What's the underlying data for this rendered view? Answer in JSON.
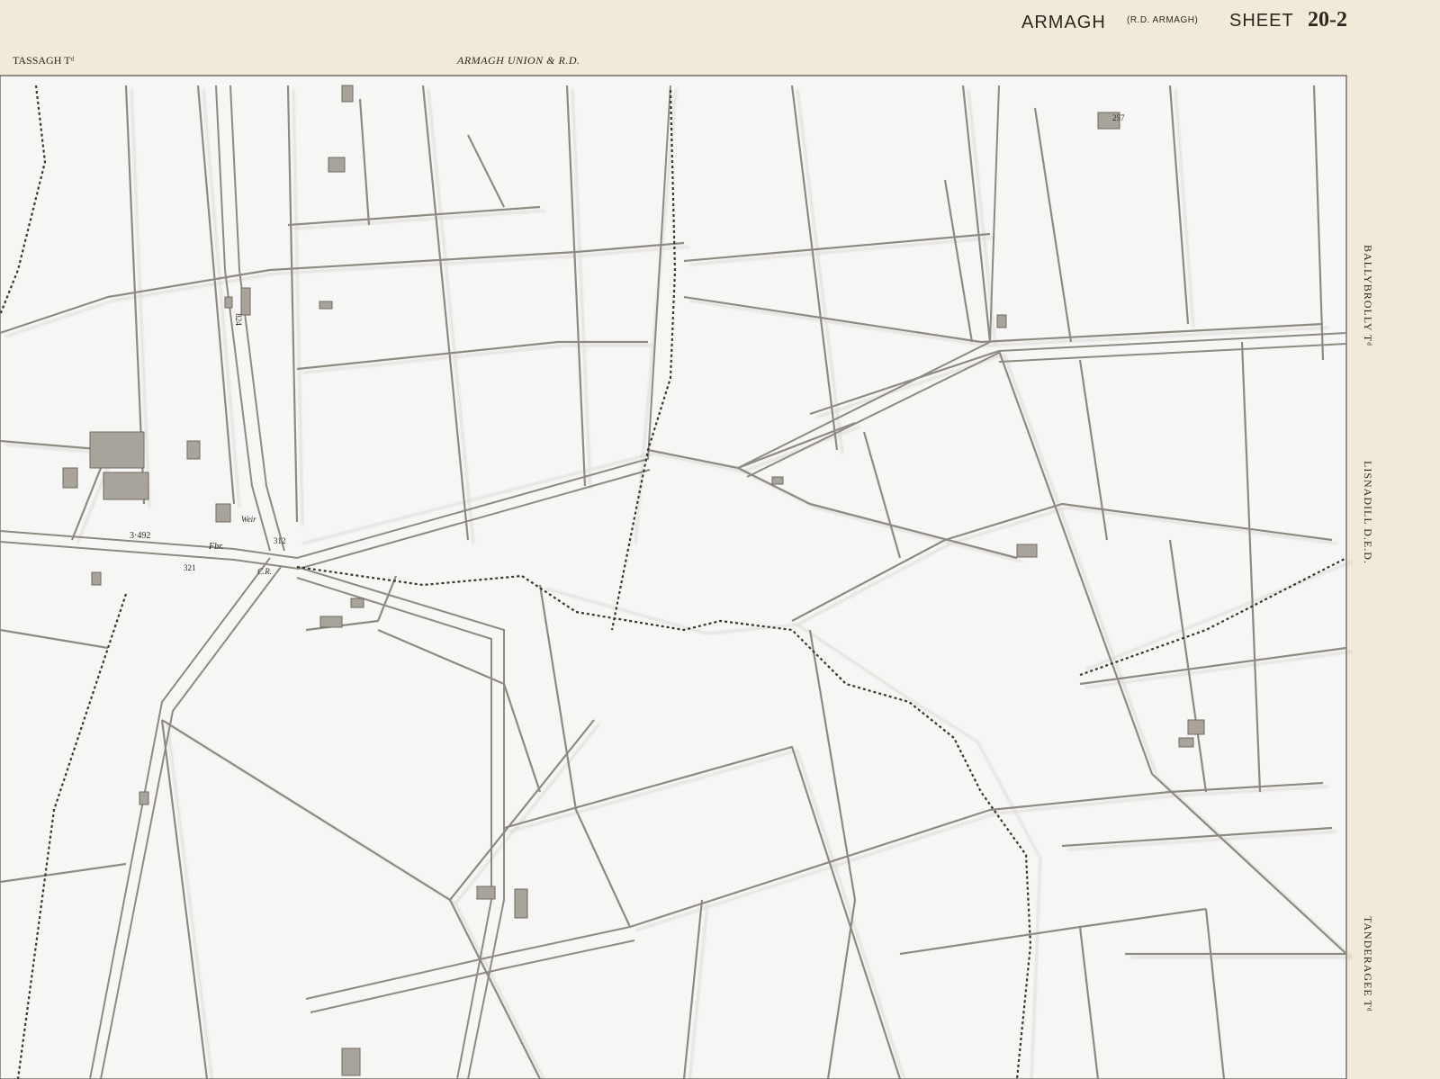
{
  "header": {
    "county": "ARMAGH",
    "rural_district": "(R.D. ARMAGH)",
    "sheet_label": "SHEET",
    "sheet_number": "20-2",
    "townland_left": "TASSAGH Tᵈ",
    "union": "ARMAGH UNION & R.D."
  },
  "margin_labels": {
    "right_townland_1": "BALLYBROLLY Tᵈ",
    "right_ded": "LISNADILL D.E.D.",
    "right_townland_2": "TANDERAGEE Tᵈ"
  },
  "map_labels": {
    "spot_height_1": "3·492",
    "spot_height_2": "321",
    "spot_height_3": "312",
    "spot_height_4": "257",
    "benchmark": "824",
    "footbridge": "Fbr.",
    "church": "C.R.",
    "weir": "Weir"
  },
  "colors": {
    "paper": "#f2ead9",
    "cut_background": "#f7f7f6",
    "line": "#8d887f",
    "boundary_dash": "#3a342c"
  }
}
